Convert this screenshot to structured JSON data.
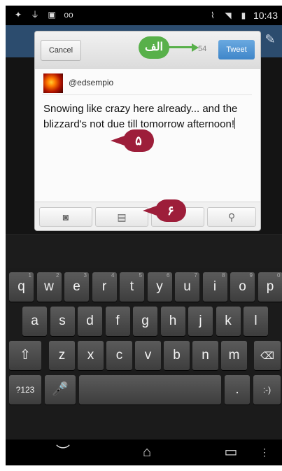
{
  "status_bar": {
    "time": "10:43",
    "left_icons": [
      "twitter-icon",
      "usb-icon",
      "image-icon",
      "voicemail-icon"
    ],
    "right_icons": [
      "vibrate-icon",
      "wifi-icon",
      "signal-icon",
      "battery-icon"
    ]
  },
  "compose": {
    "cancel_label": "Cancel",
    "char_count": "54",
    "tweet_label": "Tweet",
    "username": "@edsempio",
    "text": "Snowing like crazy here already... and the blizzard's not due till tomorrow afternoon!",
    "attachments": [
      "camera-icon",
      "gallery-icon",
      "",
      "location-icon"
    ]
  },
  "callouts": {
    "counter_label": "الف",
    "text_label": "۵",
    "gallery_label": "۶"
  },
  "keyboard": {
    "row1": [
      {
        "k": "q",
        "n": "1"
      },
      {
        "k": "w",
        "n": "2"
      },
      {
        "k": "e",
        "n": "3"
      },
      {
        "k": "r",
        "n": "4"
      },
      {
        "k": "t",
        "n": "5"
      },
      {
        "k": "y",
        "n": "6"
      },
      {
        "k": "u",
        "n": "7"
      },
      {
        "k": "i",
        "n": "8"
      },
      {
        "k": "o",
        "n": "9"
      },
      {
        "k": "p",
        "n": "0"
      }
    ],
    "row2": [
      "a",
      "s",
      "d",
      "f",
      "g",
      "h",
      "j",
      "k",
      "l"
    ],
    "row3": [
      "z",
      "x",
      "c",
      "v",
      "b",
      "n",
      "m"
    ],
    "symbols_label": "?123",
    "period_label": ".",
    "smiley_label": ":-)"
  },
  "nav": [
    "back-icon",
    "home-icon",
    "recents-icon",
    "menu-icon"
  ],
  "colors": {
    "appbar": "#2c4c6e",
    "tweet_button": "#3f86c9",
    "callout_red": "#9d1e3a",
    "callout_green": "#58b04a"
  }
}
